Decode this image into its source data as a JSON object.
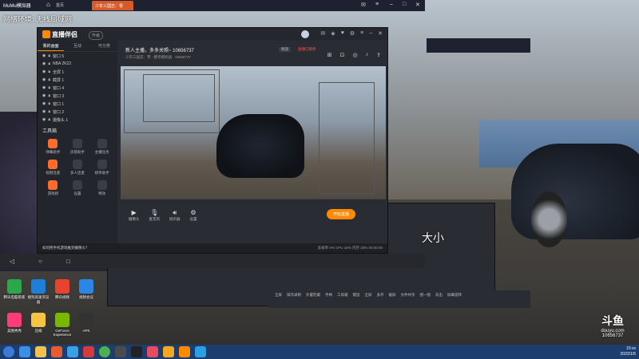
{
  "game_bar": {
    "app_name": "MuMu模拟器",
    "home_label": "首页",
    "tab_label": "少年三国志：零",
    "banner": "网络环境: 无线局域网"
  },
  "streamer": {
    "app_name": "直播伴侣",
    "version_label": "升级",
    "tabs": [
      "我的画面",
      "互动",
      "可分类"
    ],
    "sources": [
      "窗口 5",
      "NBA 2K22",
      "全屏 1",
      "截屏 1",
      "窗口 4",
      "窗口 3",
      "窗口 1",
      "窗口 2",
      "摄像头 1"
    ],
    "tools_title": "工具箱",
    "tools": [
      "弹幕助手",
      "房管助手",
      "主播任务",
      "视频连麦",
      "多人连麦",
      "榜单助手",
      "游戏榜",
      "设置",
      "特效"
    ],
    "room_title": "新人主播，多多关照~ 10656737",
    "room_tag": "频道",
    "room_status": "直播已暂停",
    "room_sub": "少年三国志：零 · 模考模拟器 · 10656737",
    "controls": [
      "摄像头",
      "麦克风",
      "扬声器",
      "设置"
    ],
    "start_button": "开始直播",
    "status_tip": "如何把手机游戏推到摄像头？",
    "stats": "丢帧率 0%  CPU 18%  内存 28%  00:00:00"
  },
  "bottom_toolbar": [
    "全屏",
    "操作录制",
    "外置陀螺",
    "手柄",
    "工具箱",
    "键鼠",
    "全屏",
    "多开",
    "截屏",
    "文件共享",
    "图一图",
    "双击",
    "屏幕旋转"
  ],
  "side_text": "大小",
  "watermark": {
    "logo": "斗鱼",
    "sub": "douyu.com",
    "room_id": "10656737"
  },
  "desktop_icons": [
    {
      "label": "腾讯电脑管家",
      "color": "#2aa84a"
    },
    {
      "label": "搜狗高速浏览器",
      "color": "#1e7fd8"
    },
    {
      "label": "腾讯视频",
      "color": "#e8432f"
    },
    {
      "label": "视频会议",
      "color": "#2b86e6"
    },
    {
      "label": "美图秀秀",
      "color": "#ff3c7a"
    },
    {
      "label": "压缩",
      "color": "#f5c542"
    },
    {
      "label": "GeForce Experience",
      "color": "#76b900"
    },
    {
      "label": "APK",
      "color": "#333333"
    }
  ],
  "taskbar": {
    "items": [
      "start",
      "ie",
      "explorer",
      "media",
      "sogou",
      "netease",
      "chrome",
      "app",
      "g",
      "qq",
      "orange",
      "orange2",
      "mumu"
    ],
    "clock_time": "15:xx",
    "clock_date": "2022/1/5"
  },
  "colors": {
    "accent": "#ff8a00",
    "live_red": "#ff5050",
    "taskbar": "#1d3d6e"
  }
}
